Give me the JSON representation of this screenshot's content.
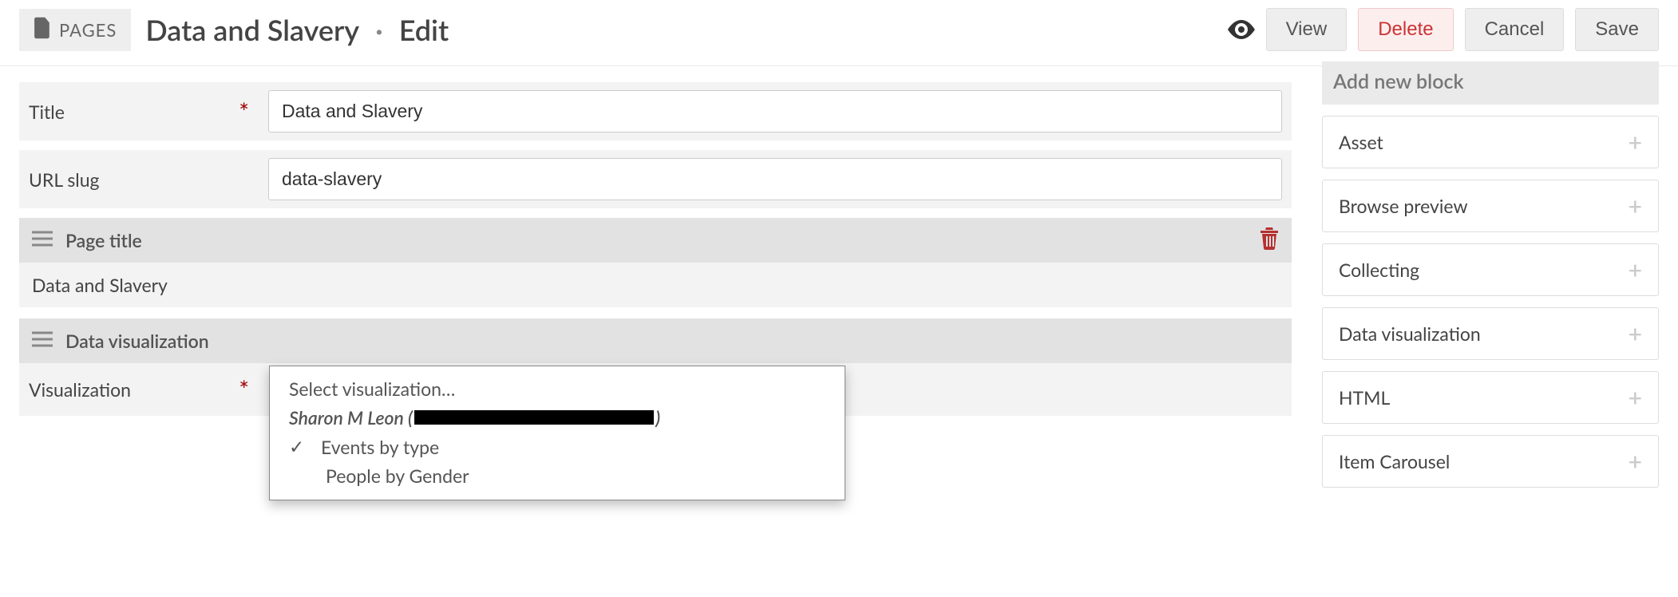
{
  "header": {
    "pages_tag": "PAGES",
    "crumb_title": "Data and Slavery",
    "crumb_action": "Edit",
    "buttons": {
      "view": "View",
      "delete": "Delete",
      "cancel": "Cancel",
      "save": "Save"
    }
  },
  "fields": {
    "title_label": "Title",
    "title_value": "Data and Slavery",
    "slug_label": "URL slug",
    "slug_value": "data-slavery"
  },
  "page_title_block": {
    "header": "Page title",
    "value": "Data and Slavery"
  },
  "viz_block": {
    "header": "Data visualization",
    "field_label": "Visualization"
  },
  "dropdown": {
    "placeholder": "Select visualization…",
    "group_owner_prefix": "Sharon M Leon (",
    "group_owner_suffix": ")",
    "options": [
      {
        "label": "Events by type",
        "selected": true
      },
      {
        "label": "People by Gender",
        "selected": false
      }
    ]
  },
  "sidebar": {
    "heading": "Add new block",
    "items": [
      {
        "label": "Asset"
      },
      {
        "label": "Browse preview"
      },
      {
        "label": "Collecting"
      },
      {
        "label": "Data visualization"
      },
      {
        "label": "HTML"
      },
      {
        "label": "Item Carousel"
      }
    ]
  }
}
